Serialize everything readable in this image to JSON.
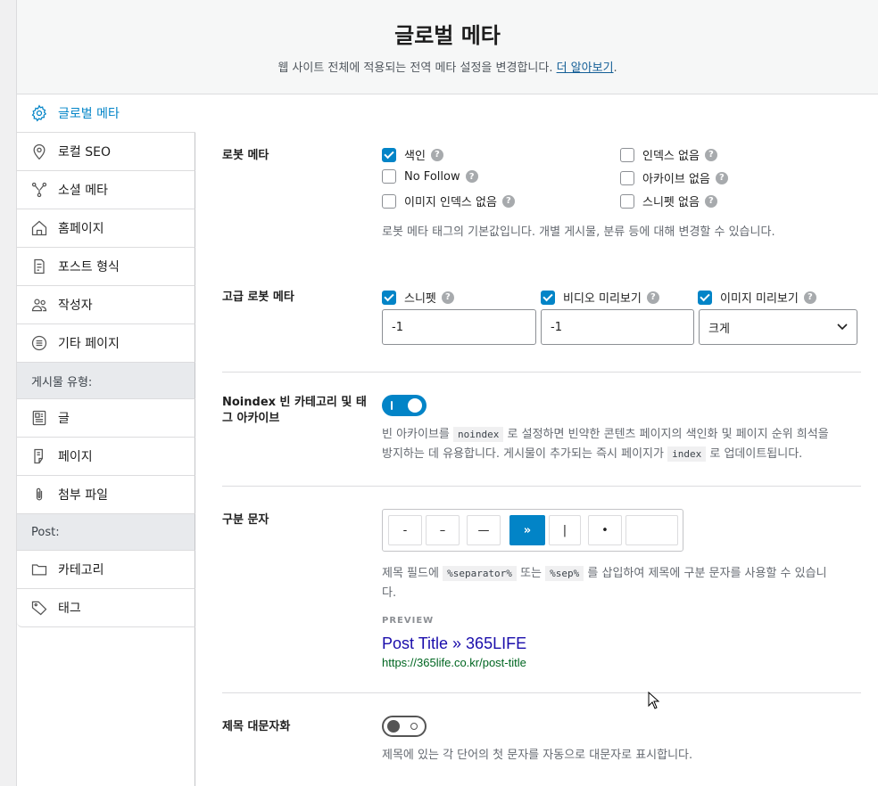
{
  "header": {
    "title": "글로벌 메타",
    "subtitle": "웹 사이트 전체에 적용되는 전역 메타 설정을 변경합니다.",
    "learn_more": "더 알아보기",
    "period": "."
  },
  "sidebar": {
    "items": [
      {
        "label": "글로벌 메타",
        "icon": "gear-icon"
      },
      {
        "label": "로컬 SEO",
        "icon": "location-pin-icon"
      },
      {
        "label": "소셜 메타",
        "icon": "share-network-icon"
      },
      {
        "label": "홈페이지",
        "icon": "home-icon"
      },
      {
        "label": "포스트 형식",
        "icon": "post-format-icon"
      },
      {
        "label": "작성자",
        "icon": "users-icon"
      },
      {
        "label": "기타 페이지",
        "icon": "list-circle-icon"
      }
    ],
    "post_types_heading": "게시물 유형:",
    "post_types": [
      {
        "label": "글",
        "icon": "post-icon"
      },
      {
        "label": "페이지",
        "icon": "page-icon"
      },
      {
        "label": "첨부 파일",
        "icon": "paperclip-icon"
      }
    ],
    "post_heading": "Post:",
    "post_taxonomies": [
      {
        "label": "카테고리",
        "icon": "folder-icon"
      },
      {
        "label": "태그",
        "icon": "tag-icon"
      }
    ]
  },
  "robots_meta": {
    "label": "로봇 메타",
    "options": [
      {
        "label": "색인",
        "checked": true
      },
      {
        "label": "인덱스 없음",
        "checked": false
      },
      {
        "label": "No Follow",
        "checked": false
      },
      {
        "label": "아카이브 없음",
        "checked": false
      },
      {
        "label": "이미지 인덱스 없음",
        "checked": false
      },
      {
        "label": "스니펫 없음",
        "checked": false
      }
    ],
    "description": "로봇 메타 태그의 기본값입니다. 개별 게시물, 분류 등에 대해 변경할 수 있습니다."
  },
  "advanced_robots": {
    "label": "고급 로봇 메타",
    "snippet_label": "스니펫",
    "snippet_value": "-1",
    "video_label": "비디오 미리보기",
    "video_value": "-1",
    "image_label": "이미지 미리보기",
    "image_value": "크게"
  },
  "noindex_empty": {
    "label": "Noindex 빈 카테고리 및 태그 아카이브",
    "enabled": true,
    "desc_1": "빈 아카이브를",
    "code_1": "noindex",
    "desc_2": "로 설정하면 빈약한 콘텐츠 페이지의 색인화 및 페이지 순위 희석을",
    "desc_3": "방지하는 데 유용합니다. 게시물이 추가되는 즉시 페이지가",
    "code_2": "index",
    "desc_4": "로 업데이트됩니다."
  },
  "separator": {
    "label": "구분 문자",
    "options": [
      "-",
      "–",
      "—",
      "»",
      "|",
      "•",
      ""
    ],
    "selected": "»",
    "desc_1": "제목 필드에",
    "code_1": "%separator%",
    "desc_2": "또는",
    "code_2": "%sep%",
    "desc_3": "를 삽입하여 제목에 구분 문자를 사용할 수 있습니",
    "desc_4": "다.",
    "preview_label": "PREVIEW",
    "preview_title": "Post Title » 365LIFE",
    "preview_url": "https://365life.co.kr/post-title"
  },
  "capitalize": {
    "label": "제목 대문자화",
    "enabled": false,
    "description": "제목에 있는 각 단어의 첫 문자를 자동으로 대문자로 표시합니다."
  }
}
